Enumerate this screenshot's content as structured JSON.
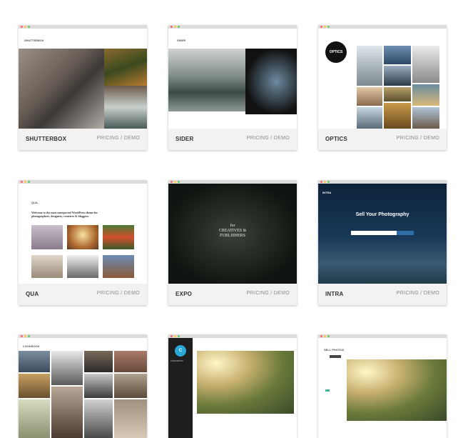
{
  "themes": [
    {
      "name": "SHUTTERBOX",
      "pricing": "PRICING",
      "demo": "DEMO",
      "logo": "SHUTTERBOX"
    },
    {
      "name": "SIDER",
      "pricing": "PRICING",
      "demo": "DEMO",
      "logo": "SIDER"
    },
    {
      "name": "OPTICS",
      "pricing": "PRICING",
      "demo": "DEMO",
      "logo": "OPTICS"
    },
    {
      "name": "QUA",
      "pricing": "PRICING",
      "demo": "DEMO",
      "logo": "QUA",
      "tagline": "Welcome to the most unexpected WordPress theme for photographers, designers, creatives & bloggers."
    },
    {
      "name": "EXPO",
      "pricing": "PRICING",
      "demo": "DEMO",
      "hero_line1": "for",
      "hero_line2": "CREATIVES &",
      "hero_line3": "PUBLISHERS"
    },
    {
      "name": "INTRA",
      "pricing": "PRICING",
      "demo": "DEMO",
      "logo": "INTRA",
      "headline": "Sell Your Photography"
    },
    {
      "name": "LOOKBOOK",
      "logo": "LOOKBOOK"
    },
    {
      "name": "CHROMATIC",
      "logo": "CHROMATIC"
    },
    {
      "name": "SELL PHOTOS",
      "logo": "SELL PHOTOS"
    }
  ],
  "separator": " / "
}
